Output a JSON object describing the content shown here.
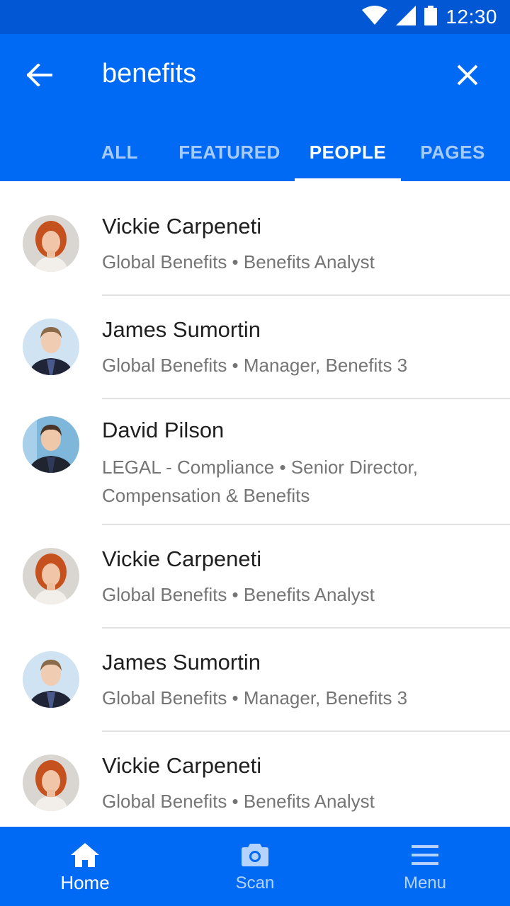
{
  "status_bar": {
    "time": "12:30"
  },
  "search": {
    "query": "benefits"
  },
  "tabs": [
    {
      "label": "ALL",
      "active": false
    },
    {
      "label": "FEATURED",
      "active": false
    },
    {
      "label": "PEOPLE",
      "active": true
    },
    {
      "label": "PAGES",
      "active": false
    }
  ],
  "people": [
    {
      "name": "Vickie Carpeneti",
      "detail": "Global Benefits • Benefits Analyst",
      "avatar": "woman-avatar"
    },
    {
      "name": "James Sumortin",
      "detail": "Global Benefits • Manager, Benefits 3",
      "avatar": "man-avatar"
    },
    {
      "name": "David Pilson",
      "detail": "LEGAL - Compliance • Senior Director, Compensation & Benefits",
      "avatar": "man-avatar"
    },
    {
      "name": "Vickie Carpeneti",
      "detail": "Global Benefits • Benefits Analyst",
      "avatar": "woman-avatar"
    },
    {
      "name": "James Sumortin",
      "detail": "Global Benefits • Manager, Benefits 3",
      "avatar": "man-avatar"
    },
    {
      "name": "Vickie Carpeneti",
      "detail": "Global Benefits • Benefits Analyst",
      "avatar": "woman-avatar"
    }
  ],
  "bottom_nav": [
    {
      "label": "Home",
      "icon": "home-icon",
      "active": true
    },
    {
      "label": "Scan",
      "icon": "camera-icon",
      "active": false
    },
    {
      "label": "Menu",
      "icon": "menu-icon",
      "active": false
    }
  ],
  "colors": {
    "primary": "#006AF5",
    "status_bar": "#0157D4",
    "text_primary": "#1F1F1F",
    "text_secondary": "#757575",
    "divider": "#E2E2E2"
  }
}
